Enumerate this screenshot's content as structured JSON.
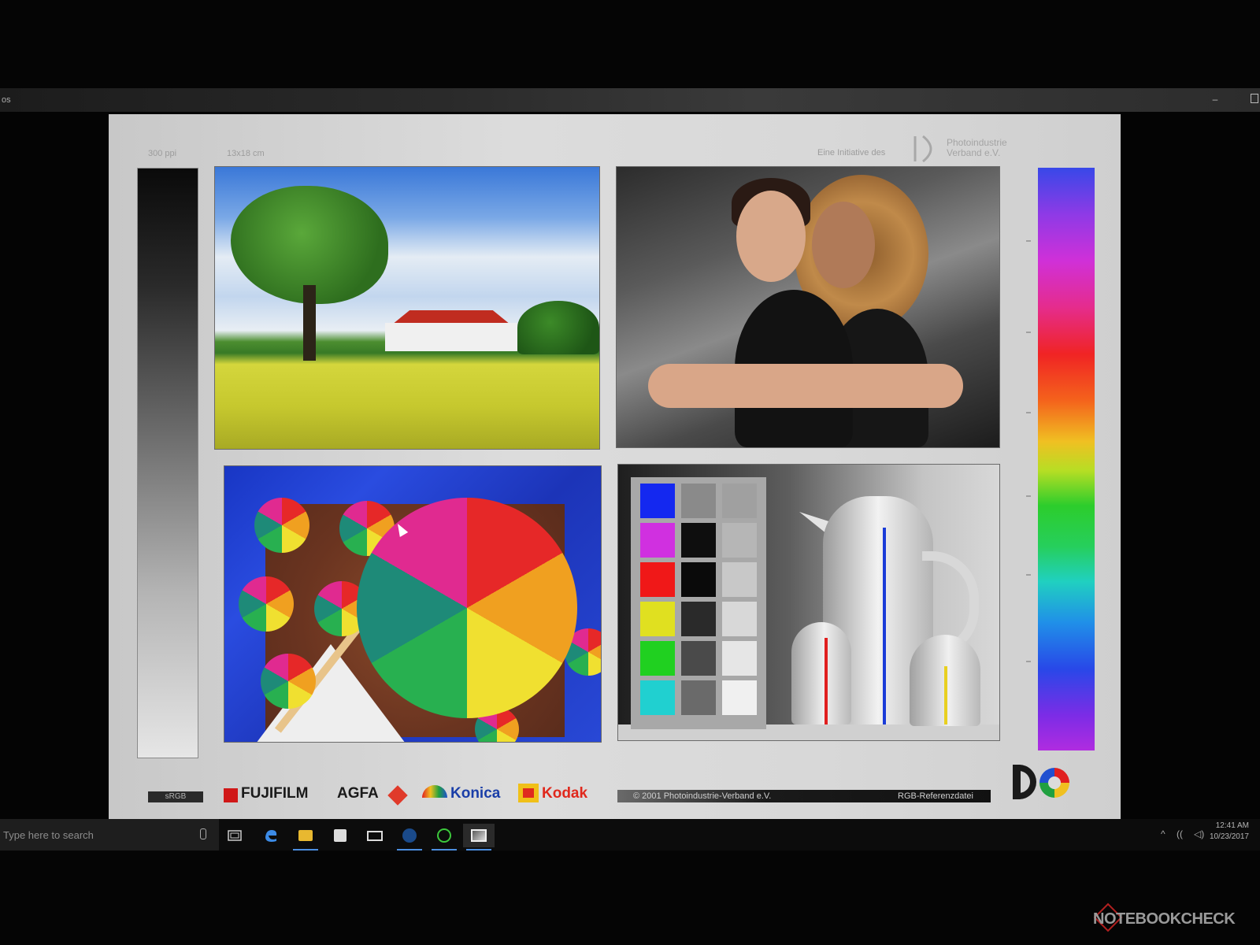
{
  "window": {
    "title_fragment": "os",
    "min_glyph": "–"
  },
  "sheet": {
    "resolution": "300 ppi",
    "size": "13x18 cm",
    "initiative": "Eine Initiative des",
    "association": "Photoindustrie Verband e.V.",
    "color_space_label": "sRGB",
    "brands": [
      "FUJIFILM",
      "AGFA",
      "Konica",
      "Kodak"
    ],
    "copyright": "© 2001 Photoindustrie-Verband e.V.",
    "file_label": "RGB-Referenzdatei"
  },
  "colors": {
    "checker_swatches": [
      "#1428f0",
      "#d030e0",
      "#f01818",
      "#e0e020",
      "#20d020",
      "#20d0d0"
    ],
    "checker_grays": [
      "#8a8a8a",
      "#0e0e0e",
      "#0a0a0a",
      "#2a2a2a",
      "#4a4a4a",
      "#6a6a6a",
      "#a0a0a0",
      "#b6b6b6",
      "#c8c8c8",
      "#d8d8d8",
      "#e6e6e6",
      "#f0f0f0"
    ]
  },
  "taskbar": {
    "search_placeholder": "Type here to search",
    "icons": [
      "task-view-icon",
      "edge-icon",
      "file-explorer-icon",
      "store-icon",
      "mail-icon",
      "steam-icon",
      "green-app-icon",
      "photos-icon"
    ],
    "tray": {
      "chevron": "^",
      "network": "((",
      "volume": "◁)"
    },
    "time": "12:41 AM",
    "date": "10/23/2017"
  },
  "watermark": "NOTEBOOKCHECK"
}
